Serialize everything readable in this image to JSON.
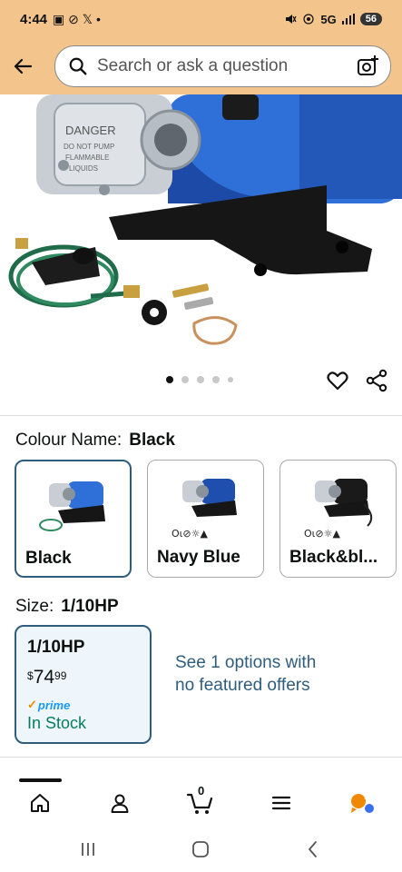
{
  "status_bar": {
    "time": "4:44",
    "left_icons": "▣ ⊘ 𝕏 •",
    "network": "5G",
    "battery": "56"
  },
  "search": {
    "placeholder": "Search or ask a question"
  },
  "carousel": {
    "count": 5,
    "active_index": 0
  },
  "colour": {
    "label": "Colour Name:",
    "selected": "Black",
    "options": [
      {
        "name": "Black",
        "selected": true
      },
      {
        "name": "Navy Blue",
        "selected": false
      },
      {
        "name": "Black&bl...",
        "selected": false
      }
    ]
  },
  "size": {
    "label": "Size:",
    "selected": "1/10HP",
    "option": {
      "name": "1/10HP",
      "currency": "$",
      "price_whole": "74",
      "price_fraction": "99",
      "prime_label": "prime",
      "stock": "In Stock"
    },
    "see_options": "See 1 options with no featured offers"
  },
  "bottom_nav": {
    "cart_count": "0",
    "items": [
      "home",
      "account",
      "cart",
      "menu",
      "rufus"
    ]
  },
  "colors": {
    "header_bg": "#f3c58d",
    "selected_border": "#2f5d7e",
    "link": "#2f5d7e",
    "in_stock": "#067d62",
    "prime": "#1a98ff",
    "accent_orange": "#f08804"
  }
}
